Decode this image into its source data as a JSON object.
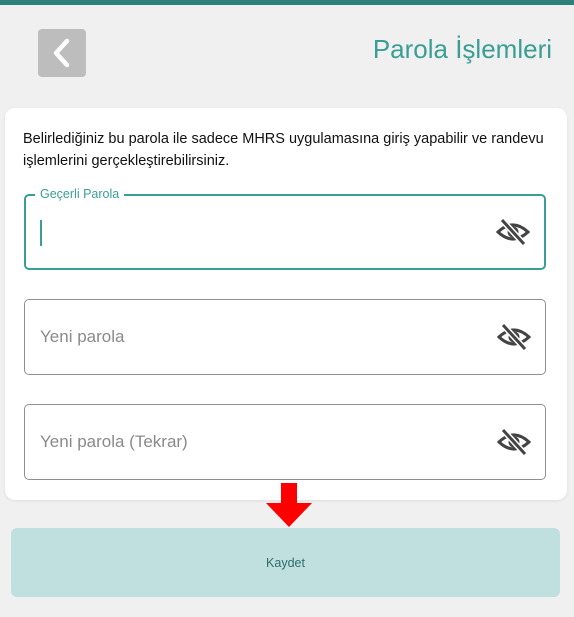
{
  "header": {
    "title": "Parola İşlemleri",
    "back_icon": "chevron-left-icon"
  },
  "card": {
    "description": "Belirlediğiniz bu parola ile sadece MHRS uygulamasına giriş yapabilir ve randevu işlemlerini gerçekleştirebilirsiniz.",
    "fields": [
      {
        "label": "Geçerli Parola",
        "value": "",
        "focused": true,
        "icon": "eye-slash-icon"
      },
      {
        "placeholder": "Yeni parola",
        "value": "",
        "icon": "eye-slash-icon"
      },
      {
        "placeholder": "Yeni parola (Tekrar)",
        "value": "",
        "icon": "eye-slash-icon"
      }
    ]
  },
  "save_button": {
    "label": "Kaydet"
  },
  "annotation": {
    "icon": "red-down-arrow-icon"
  },
  "colors": {
    "accent": "#3a9e95",
    "topbar": "#2f7f7a",
    "button_bg": "#bfe0df",
    "arrow": "#ff0000"
  }
}
